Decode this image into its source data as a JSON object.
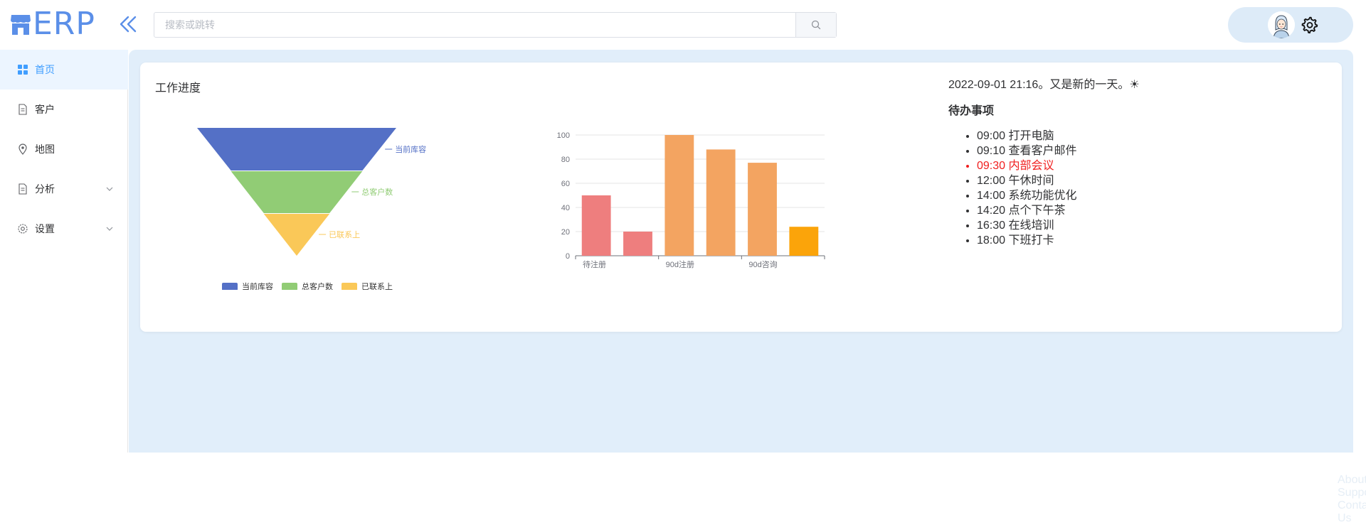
{
  "app": {
    "name": "ERP"
  },
  "search": {
    "placeholder": "搜索或跳转"
  },
  "sidebar": {
    "items": [
      {
        "label": "首页",
        "icon": "grid-icon",
        "active": true
      },
      {
        "label": "客户",
        "icon": "document-icon"
      },
      {
        "label": "地图",
        "icon": "location-icon"
      },
      {
        "label": "分析",
        "icon": "document-icon",
        "expandable": true
      },
      {
        "label": "设置",
        "icon": "gear-icon",
        "expandable": true
      }
    ]
  },
  "main": {
    "card_title": "工作进度",
    "datetime": "2022-09-01 21:16。又是新的一天。☀",
    "todo_title": "待办事项",
    "todos": [
      {
        "text": "09:00 打开电脑"
      },
      {
        "text": "09:10 查看客户邮件"
      },
      {
        "text": "09:30 内部会议",
        "urgent": true
      },
      {
        "text": "12:00 午休时间"
      },
      {
        "text": "14:00 系统功能优化"
      },
      {
        "text": "14:20 点个下午茶"
      },
      {
        "text": "16:30 在线培训"
      },
      {
        "text": "18:00 下班打卡"
      }
    ]
  },
  "footer": {
    "links": [
      "About",
      "Support",
      "Contact Us"
    ]
  },
  "chart_data": [
    {
      "type": "funnel",
      "series": [
        {
          "name": "当前库容",
          "value": 100,
          "color": "#5470c6"
        },
        {
          "name": "总客户数",
          "value": 66,
          "color": "#91cc75"
        },
        {
          "name": "已联系上",
          "value": 33,
          "color": "#fac858"
        }
      ],
      "legend": "bottom"
    },
    {
      "type": "bar",
      "categories": [
        "",
        "待注册",
        "",
        "90d注册",
        "",
        "90d咨询",
        ""
      ],
      "x_labels": [
        "待注册",
        "90d注册",
        "90d咨询"
      ],
      "values": [
        50,
        20,
        100,
        88,
        77,
        24
      ],
      "colors": [
        "#ee7e7e",
        "#ee7e7e",
        "#f3a461",
        "#f3a461",
        "#f3a461",
        "#fba40a"
      ],
      "ylim": [
        0,
        100
      ],
      "yticks": [
        0,
        20,
        40,
        60,
        80,
        100
      ],
      "grid": true
    }
  ]
}
